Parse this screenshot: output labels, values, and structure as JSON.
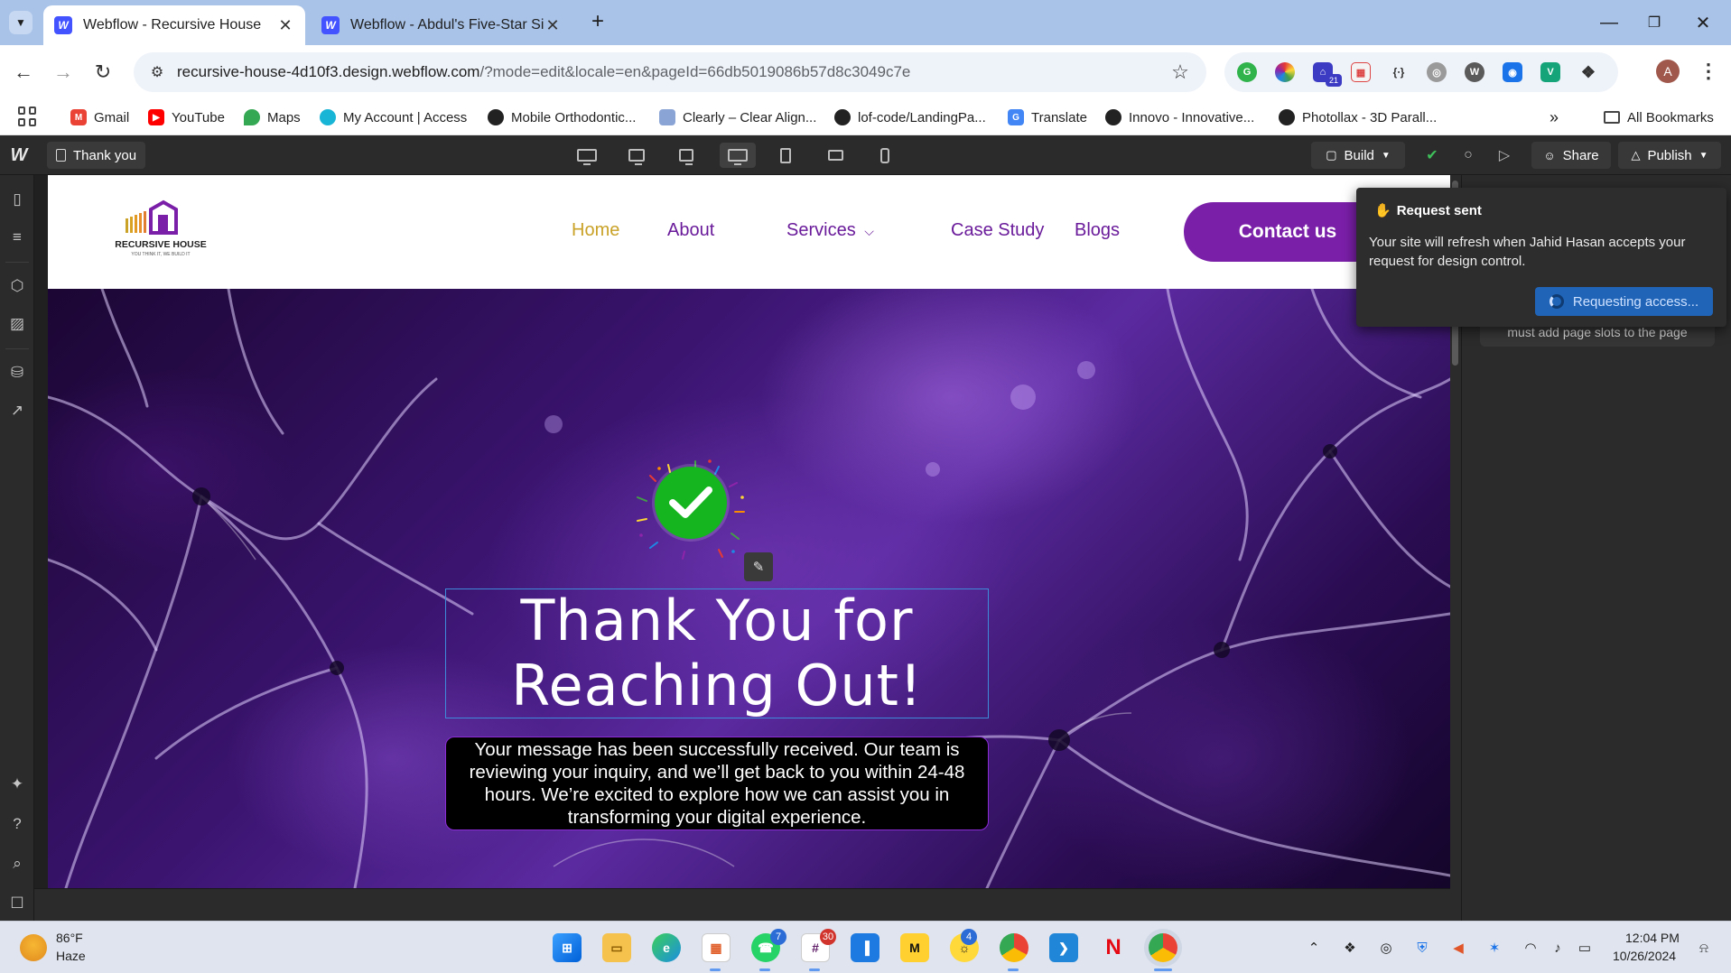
{
  "browser": {
    "tabs": [
      {
        "title": "Webflow - Recursive House",
        "favicon": "W",
        "active": true
      },
      {
        "title": "Webflow - Abdul's Five-Star Site",
        "favicon": "W",
        "active": false
      }
    ],
    "url_host": "recursive-house-4d10f3.design.webflow.com",
    "url_rest": "/?mode=edit&locale=en&pageId=66db5019086b57d8c3049c7e",
    "avatar_letter": "A",
    "extension_badge": "21",
    "bookmarks": [
      {
        "label": "Gmail",
        "icon": "gmail-icon",
        "color": "#ea4335"
      },
      {
        "label": "YouTube",
        "icon": "youtube-icon",
        "color": "#ff0000"
      },
      {
        "label": "Maps",
        "icon": "maps-icon",
        "color": "#34a853"
      },
      {
        "label": "My Account | Access",
        "icon": "access-icon",
        "color": "#19b5d6"
      },
      {
        "label": "Mobile Orthodontic...",
        "icon": "globe-icon",
        "color": "#222222"
      },
      {
        "label": "Clearly – Clear Align...",
        "icon": "clearly-icon",
        "color": "#8aa4d6"
      },
      {
        "label": "lof-code/LandingPa...",
        "icon": "github-icon",
        "color": "#222222"
      },
      {
        "label": "Translate",
        "icon": "translate-icon",
        "color": "#4285f4"
      },
      {
        "label": "Innovo - Innovative...",
        "icon": "globe-icon",
        "color": "#222222"
      },
      {
        "label": "Photollax - 3D Parall...",
        "icon": "globe-icon",
        "color": "#222222"
      }
    ],
    "all_bookmarks": "All Bookmarks"
  },
  "designer": {
    "page_name": "Thank you",
    "build_label": "Build",
    "share_label": "Share",
    "publish_label": "Publish",
    "right_panel_note": "must add page slots to the page"
  },
  "site": {
    "logo_text": "RECURSIVE HOUSE",
    "logo_tagline": "YOU THINK IT, WE BUILD IT",
    "nav": [
      {
        "label": "Home",
        "active": true
      },
      {
        "label": "About",
        "active": false
      },
      {
        "label": "Services",
        "active": false,
        "dropdown": true
      },
      {
        "label": "Case Study",
        "active": false
      },
      {
        "label": "Blogs",
        "active": false
      }
    ],
    "contact_label": "Contact us",
    "heading": "Thank You for Reaching Out!",
    "message": "Your message has been successfully received. Our team is reviewing your inquiry, and we’ll get back to you within 24-48 hours. We’re excited to explore how we can assist you in transforming your digital experience.",
    "colors": {
      "brand_purple": "#7a1fa8",
      "active_nav": "#c9a227",
      "success_green": "#14b51f"
    }
  },
  "toast": {
    "title": "Request sent",
    "body": "Your site will refresh when Jahid Hasan accepts your request for design control.",
    "button": "Requesting access..."
  },
  "taskbar": {
    "temperature": "86°F",
    "condition": "Haze",
    "time": "12:04 PM",
    "date": "10/26/2024",
    "badges": {
      "whatsapp": "7",
      "slack": "30",
      "messenger": "4"
    }
  }
}
